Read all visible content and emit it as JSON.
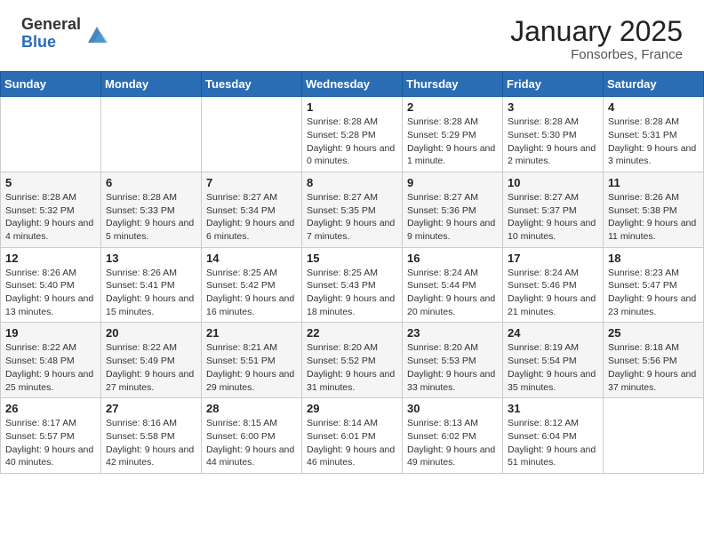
{
  "header": {
    "logo_general": "General",
    "logo_blue": "Blue",
    "month_title": "January 2025",
    "location": "Fonsorbes, France"
  },
  "days_of_week": [
    "Sunday",
    "Monday",
    "Tuesday",
    "Wednesday",
    "Thursday",
    "Friday",
    "Saturday"
  ],
  "weeks": [
    [
      {
        "day": "",
        "sunrise": "",
        "sunset": "",
        "daylight": ""
      },
      {
        "day": "",
        "sunrise": "",
        "sunset": "",
        "daylight": ""
      },
      {
        "day": "",
        "sunrise": "",
        "sunset": "",
        "daylight": ""
      },
      {
        "day": "1",
        "sunrise": "Sunrise: 8:28 AM",
        "sunset": "Sunset: 5:28 PM",
        "daylight": "Daylight: 9 hours and 0 minutes."
      },
      {
        "day": "2",
        "sunrise": "Sunrise: 8:28 AM",
        "sunset": "Sunset: 5:29 PM",
        "daylight": "Daylight: 9 hours and 1 minute."
      },
      {
        "day": "3",
        "sunrise": "Sunrise: 8:28 AM",
        "sunset": "Sunset: 5:30 PM",
        "daylight": "Daylight: 9 hours and 2 minutes."
      },
      {
        "day": "4",
        "sunrise": "Sunrise: 8:28 AM",
        "sunset": "Sunset: 5:31 PM",
        "daylight": "Daylight: 9 hours and 3 minutes."
      }
    ],
    [
      {
        "day": "5",
        "sunrise": "Sunrise: 8:28 AM",
        "sunset": "Sunset: 5:32 PM",
        "daylight": "Daylight: 9 hours and 4 minutes."
      },
      {
        "day": "6",
        "sunrise": "Sunrise: 8:28 AM",
        "sunset": "Sunset: 5:33 PM",
        "daylight": "Daylight: 9 hours and 5 minutes."
      },
      {
        "day": "7",
        "sunrise": "Sunrise: 8:27 AM",
        "sunset": "Sunset: 5:34 PM",
        "daylight": "Daylight: 9 hours and 6 minutes."
      },
      {
        "day": "8",
        "sunrise": "Sunrise: 8:27 AM",
        "sunset": "Sunset: 5:35 PM",
        "daylight": "Daylight: 9 hours and 7 minutes."
      },
      {
        "day": "9",
        "sunrise": "Sunrise: 8:27 AM",
        "sunset": "Sunset: 5:36 PM",
        "daylight": "Daylight: 9 hours and 9 minutes."
      },
      {
        "day": "10",
        "sunrise": "Sunrise: 8:27 AM",
        "sunset": "Sunset: 5:37 PM",
        "daylight": "Daylight: 9 hours and 10 minutes."
      },
      {
        "day": "11",
        "sunrise": "Sunrise: 8:26 AM",
        "sunset": "Sunset: 5:38 PM",
        "daylight": "Daylight: 9 hours and 11 minutes."
      }
    ],
    [
      {
        "day": "12",
        "sunrise": "Sunrise: 8:26 AM",
        "sunset": "Sunset: 5:40 PM",
        "daylight": "Daylight: 9 hours and 13 minutes."
      },
      {
        "day": "13",
        "sunrise": "Sunrise: 8:26 AM",
        "sunset": "Sunset: 5:41 PM",
        "daylight": "Daylight: 9 hours and 15 minutes."
      },
      {
        "day": "14",
        "sunrise": "Sunrise: 8:25 AM",
        "sunset": "Sunset: 5:42 PM",
        "daylight": "Daylight: 9 hours and 16 minutes."
      },
      {
        "day": "15",
        "sunrise": "Sunrise: 8:25 AM",
        "sunset": "Sunset: 5:43 PM",
        "daylight": "Daylight: 9 hours and 18 minutes."
      },
      {
        "day": "16",
        "sunrise": "Sunrise: 8:24 AM",
        "sunset": "Sunset: 5:44 PM",
        "daylight": "Daylight: 9 hours and 20 minutes."
      },
      {
        "day": "17",
        "sunrise": "Sunrise: 8:24 AM",
        "sunset": "Sunset: 5:46 PM",
        "daylight": "Daylight: 9 hours and 21 minutes."
      },
      {
        "day": "18",
        "sunrise": "Sunrise: 8:23 AM",
        "sunset": "Sunset: 5:47 PM",
        "daylight": "Daylight: 9 hours and 23 minutes."
      }
    ],
    [
      {
        "day": "19",
        "sunrise": "Sunrise: 8:22 AM",
        "sunset": "Sunset: 5:48 PM",
        "daylight": "Daylight: 9 hours and 25 minutes."
      },
      {
        "day": "20",
        "sunrise": "Sunrise: 8:22 AM",
        "sunset": "Sunset: 5:49 PM",
        "daylight": "Daylight: 9 hours and 27 minutes."
      },
      {
        "day": "21",
        "sunrise": "Sunrise: 8:21 AM",
        "sunset": "Sunset: 5:51 PM",
        "daylight": "Daylight: 9 hours and 29 minutes."
      },
      {
        "day": "22",
        "sunrise": "Sunrise: 8:20 AM",
        "sunset": "Sunset: 5:52 PM",
        "daylight": "Daylight: 9 hours and 31 minutes."
      },
      {
        "day": "23",
        "sunrise": "Sunrise: 8:20 AM",
        "sunset": "Sunset: 5:53 PM",
        "daylight": "Daylight: 9 hours and 33 minutes."
      },
      {
        "day": "24",
        "sunrise": "Sunrise: 8:19 AM",
        "sunset": "Sunset: 5:54 PM",
        "daylight": "Daylight: 9 hours and 35 minutes."
      },
      {
        "day": "25",
        "sunrise": "Sunrise: 8:18 AM",
        "sunset": "Sunset: 5:56 PM",
        "daylight": "Daylight: 9 hours and 37 minutes."
      }
    ],
    [
      {
        "day": "26",
        "sunrise": "Sunrise: 8:17 AM",
        "sunset": "Sunset: 5:57 PM",
        "daylight": "Daylight: 9 hours and 40 minutes."
      },
      {
        "day": "27",
        "sunrise": "Sunrise: 8:16 AM",
        "sunset": "Sunset: 5:58 PM",
        "daylight": "Daylight: 9 hours and 42 minutes."
      },
      {
        "day": "28",
        "sunrise": "Sunrise: 8:15 AM",
        "sunset": "Sunset: 6:00 PM",
        "daylight": "Daylight: 9 hours and 44 minutes."
      },
      {
        "day": "29",
        "sunrise": "Sunrise: 8:14 AM",
        "sunset": "Sunset: 6:01 PM",
        "daylight": "Daylight: 9 hours and 46 minutes."
      },
      {
        "day": "30",
        "sunrise": "Sunrise: 8:13 AM",
        "sunset": "Sunset: 6:02 PM",
        "daylight": "Daylight: 9 hours and 49 minutes."
      },
      {
        "day": "31",
        "sunrise": "Sunrise: 8:12 AM",
        "sunset": "Sunset: 6:04 PM",
        "daylight": "Daylight: 9 hours and 51 minutes."
      },
      {
        "day": "",
        "sunrise": "",
        "sunset": "",
        "daylight": ""
      }
    ]
  ]
}
